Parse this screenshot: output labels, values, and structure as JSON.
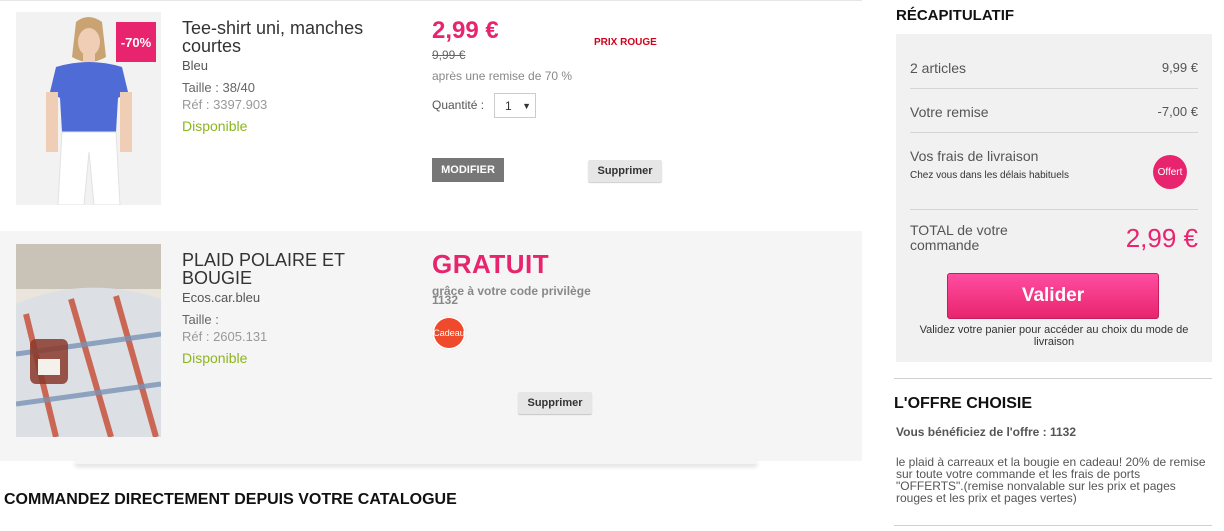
{
  "items": [
    {
      "name": "Tee-shirt uni, manches courtes",
      "color": "Bleu",
      "size": "Taille : 38/40",
      "ref": "Réf : 3397.903",
      "availability": "Disponible",
      "discount_badge": "-70%",
      "price": "2,99 €",
      "old_price": "9,99 €",
      "discount_note": "après une remise de 70 %",
      "promo_tag": "PRIX ROUGE",
      "quantity_label": "Quantité :",
      "quantity_value": "1",
      "modify_label": "MODIFIER",
      "delete_label": "Supprimer"
    },
    {
      "name": "PLAID POLAIRE ET BOUGIE",
      "color": "Ecos.car.bleu",
      "size": "Taille :",
      "ref": "Réf : 2605.131",
      "availability": "Disponible",
      "price": "GRATUIT",
      "code_note": "grâce à votre code privilège 1132",
      "gift_badge": "Cadeau",
      "delete_label": "Supprimer"
    }
  ],
  "catalog_title": "COMMANDEZ DIRECTEMENT DEPUIS VOTRE CATALOGUE",
  "summary": {
    "title": "RÉCAPITULATIF",
    "articles_label": "2 articles",
    "articles_value": "9,99 €",
    "discount_label": "Votre remise",
    "discount_value": "-7,00 €",
    "shipping_label": "Vos frais de livraison",
    "shipping_sub": "Chez vous dans les délais habituels",
    "shipping_badge": "Offert",
    "total_label": "TOTAL de votre commande",
    "total_value": "2,99 €",
    "validate_label": "Valider",
    "validate_note": "Validez votre panier pour accéder au choix du mode de livraison"
  },
  "offer": {
    "title": "L'OFFRE CHOISIE",
    "subtitle": "Vous bénéficiez de l'offre : 1132",
    "description": "le plaid à carreaux et la bougie en cadeau! 20% de remise sur toute votre commande et les frais de ports \"OFFERTS\".(remise nonvalable sur les prix et pages rouges et les prix et pages vertes)"
  },
  "colors": {
    "accent": "#e8246e",
    "available": "#8db520",
    "promo_red": "#d0021b",
    "gift": "#ee4a2b"
  }
}
